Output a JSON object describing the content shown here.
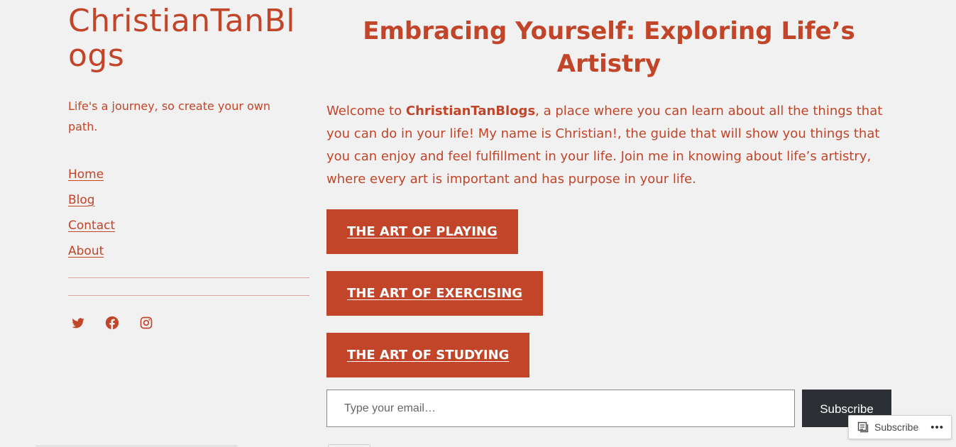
{
  "site": {
    "title": "ChristianTanBlogs",
    "tagline": "Life's a journey, so create your own path."
  },
  "nav": {
    "items": [
      {
        "label": "Home"
      },
      {
        "label": "Blog"
      },
      {
        "label": "Contact"
      },
      {
        "label": "About"
      }
    ]
  },
  "social": {
    "icons": [
      "twitter-icon",
      "facebook-icon",
      "instagram-icon"
    ]
  },
  "main": {
    "headline": "Embracing Yourself: Exploring Life’s Artistry",
    "intro_prefix": "Welcome to ",
    "intro_brand": "ChristianTanBlogs",
    "intro_rest": ", a place where you can learn about all the things that you can do in your life! My name is Christian!, the guide that will show you things that you can enjoy and feel fulfillment in your life. Join me in knowing about life’s artistry, where every art is important and has purpose in your life.",
    "buttons": [
      {
        "label": "THE ART OF PLAYING"
      },
      {
        "label": "THE ART OF EXERCISING"
      },
      {
        "label": "THE ART OF STUDYING"
      }
    ]
  },
  "subscribe": {
    "placeholder": "Type your email…",
    "button_label": "Subscribe"
  },
  "floating_widget": {
    "label": "Subscribe",
    "more": "•••"
  },
  "colors": {
    "accent": "#c2452a",
    "background": "#f0f1f0",
    "dark_button": "#2c3035"
  }
}
